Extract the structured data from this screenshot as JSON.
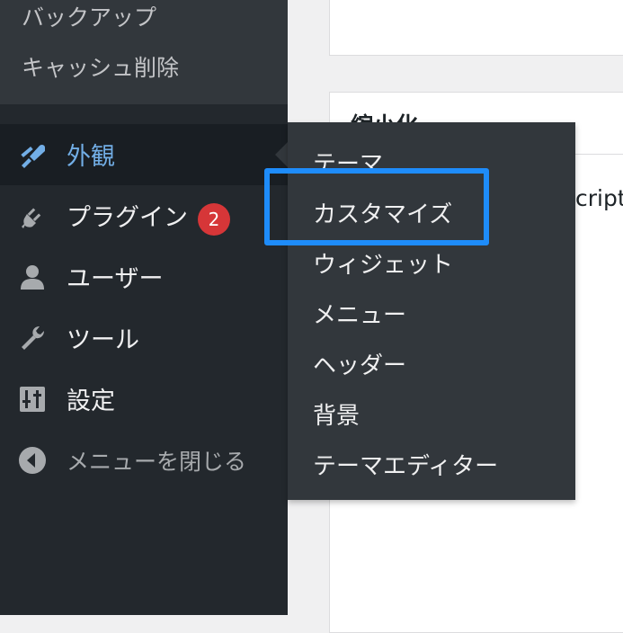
{
  "sidebar": {
    "top_submenu": [
      "バックアップ",
      "キャッシュ削除"
    ],
    "items": [
      {
        "label": "外観",
        "icon": "paint-brush-icon",
        "active": true
      },
      {
        "label": "プラグイン",
        "icon": "plugin-icon",
        "badge": "2"
      },
      {
        "label": "ユーザー",
        "icon": "user-icon"
      },
      {
        "label": "ツール",
        "icon": "wrench-icon"
      },
      {
        "label": "設定",
        "icon": "settings-sliders-icon"
      },
      {
        "label": "メニューを閉じる",
        "icon": "collapse-arrow-icon"
      }
    ]
  },
  "flyout": {
    "items": [
      "テーマ",
      "カスタマイズ",
      "ウィジェット",
      "メニュー",
      "ヘッダー",
      "背景",
      "テーマエディター"
    ],
    "highlighted": "カスタマイズ"
  },
  "main": {
    "panel_title": "縮小化",
    "partial_text": "cript"
  },
  "colors": {
    "sidebar_bg": "#23282d",
    "submenu_bg": "#32373c",
    "active_text": "#72aee6",
    "badge": "#d63638",
    "highlight": "#1e8cfa"
  }
}
